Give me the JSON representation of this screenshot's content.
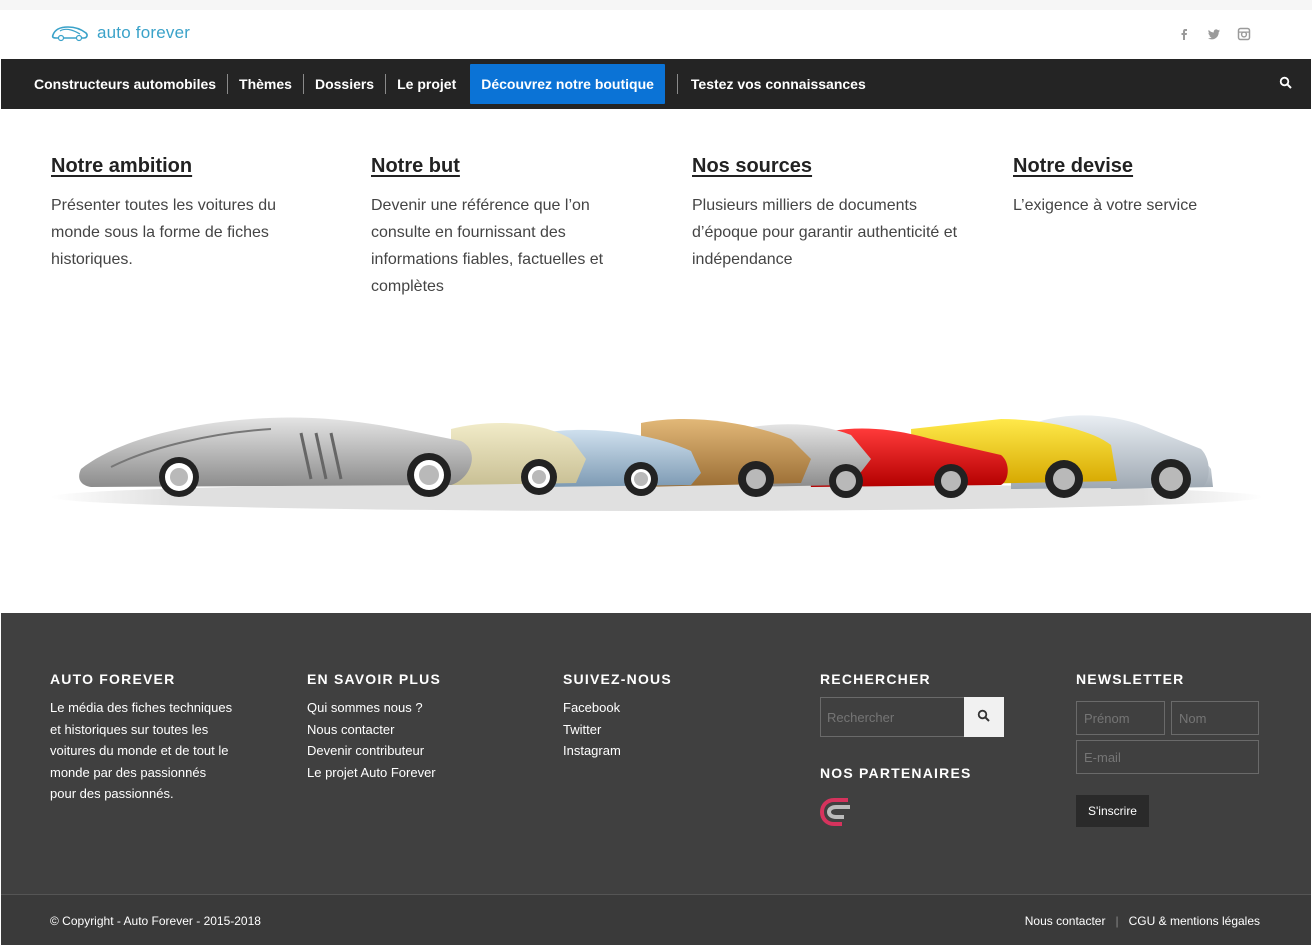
{
  "header": {
    "logo_text": "auto forever",
    "social_icons": [
      "facebook-icon",
      "twitter-icon",
      "instagram-icon"
    ]
  },
  "nav": {
    "items": [
      {
        "label": "Constructeurs automobiles"
      },
      {
        "label": "Thèmes"
      },
      {
        "label": "Dossiers"
      },
      {
        "label": "Le projet"
      },
      {
        "label": "Découvrez notre boutique",
        "active": true
      },
      {
        "label": "Testez vos connaissances"
      }
    ],
    "accent": "#0b73d6"
  },
  "features": [
    {
      "title": "Notre ambition",
      "text": "Présenter toutes les voitures du monde sous la forme de fiches historiques."
    },
    {
      "title": "Notre but",
      "text": "Devenir une référence que l’on consulte en fournissant des informations fiables, factuelles et complètes"
    },
    {
      "title": "Nos sources",
      "text": "Plusieurs milliers de documents d’époque pour garantir authenticité et indépendance"
    },
    {
      "title": "Notre devise",
      "text": "L’exigence à votre service"
    }
  ],
  "footer": {
    "about": {
      "title": "AUTO FOREVER",
      "text": "Le média des fiches techniques et historiques sur toutes les voitures du monde et de tout le monde par des passionnés pour des passionnés."
    },
    "more": {
      "title": "EN SAVOIR PLUS",
      "links": [
        "Qui sommes nous ?",
        "Nous contacter",
        "Devenir contributeur",
        "Le projet Auto Forever"
      ]
    },
    "follow": {
      "title": "SUIVEZ-NOUS",
      "links": [
        "Facebook",
        "Twitter",
        "Instagram"
      ]
    },
    "search": {
      "title": "RECHERCHER",
      "placeholder": "Rechercher",
      "partners_title": "NOS PARTENAIRES"
    },
    "newsletter": {
      "title": "NEWSLETTER",
      "firstname_placeholder": "Prénom",
      "lastname_placeholder": "Nom",
      "email_placeholder": "E-mail",
      "submit_label": "S'inscrire"
    }
  },
  "bottom": {
    "copyright": "© Copyright - Auto Forever - 2015-2018",
    "links": [
      "Nous contacter",
      "CGU & mentions légales"
    ]
  }
}
